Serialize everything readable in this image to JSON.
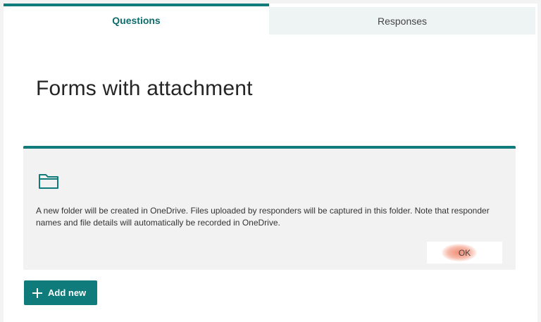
{
  "tabs": {
    "questions": "Questions",
    "responses": "Responses"
  },
  "form": {
    "title": "Forms with attachment"
  },
  "notice": {
    "icon": "folder-icon",
    "message": "A new folder will be created in OneDrive. Files uploaded by responders will be captured in this folder. Note that responder names and file details will automatically be recorded in OneDrive.",
    "ok_label": "OK"
  },
  "actions": {
    "add_new_label": "Add new"
  },
  "colors": {
    "accent": "#0f7b7b",
    "notice_background": "#f2f2f2"
  }
}
